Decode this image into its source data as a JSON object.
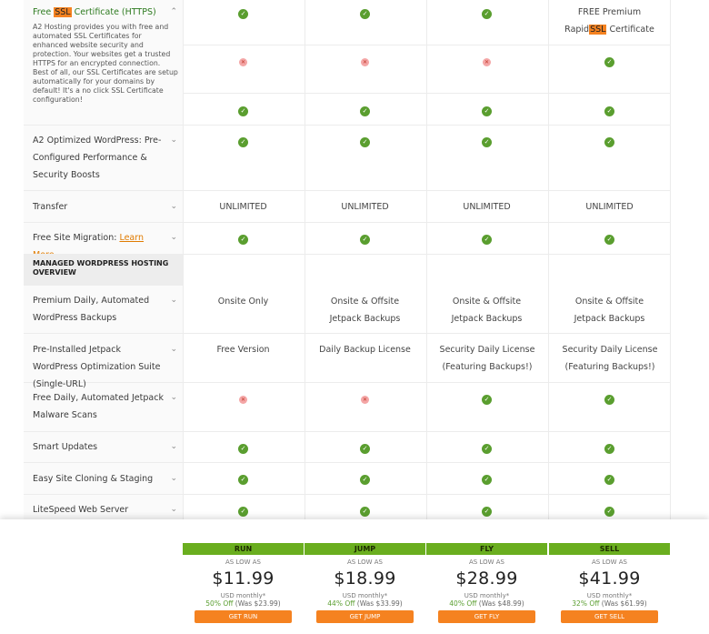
{
  "features": {
    "ssl": {
      "label_pre": "Free ",
      "label_hl": "SSL",
      "label_post": " Certificate (HTTPS)",
      "description": "A2 Hosting provides you with free and automated SSL Certificates for enhanced website security and protection. Your websites get a trusted HTTPS for an encrypted connection. Best of all, our SSL Certificates are setup automatically for your domains by default! It's a no click SSL Certificate configuration!",
      "sell_line1": "FREE Premium",
      "sell_pre": "Rapid",
      "sell_hl": "SSL",
      "sell_post": " Certificate"
    },
    "wp": {
      "label": "A2 Optimized WordPress: Pre-Configured Performance & Security Boosts"
    },
    "transfer": {
      "label": "Transfer",
      "value": "UNLIMITED"
    },
    "migration": {
      "label": "Free Site Migration: ",
      "link": "Learn More"
    },
    "section_title": "MANAGED WORDPRESS HOSTING OVERVIEW",
    "backups": {
      "label": "Premium Daily, Automated WordPress Backups",
      "run": "Onsite Only",
      "other": "Onsite & Offsite Jetpack Backups"
    },
    "jetpack": {
      "label": "Pre-Installed Jetpack WordPress Optimization Suite (Single-URL)",
      "run": "Free Version",
      "jump": "Daily Backup License",
      "fly": "Security Daily License (Featuring Backups!)",
      "sell": "Security Daily License (Featuring Backups!)"
    },
    "malware": {
      "label": "Free Daily, Automated Jetpack Malware Scans"
    },
    "smart": {
      "label": "Smart Updates"
    },
    "cloning": {
      "label": "Easy Site Cloning & Staging"
    },
    "litespeed": {
      "label": "LiteSpeed Web Server"
    }
  },
  "plans": [
    {
      "name": "RUN",
      "low": "AS LOW AS",
      "price": "$11.99",
      "monthly": "USD monthly*",
      "off": "50% Off",
      "was": "(Was $23.99)",
      "button": "GET RUN"
    },
    {
      "name": "JUMP",
      "low": "AS LOW AS",
      "price": "$18.99",
      "monthly": "USD monthly*",
      "off": "44% Off",
      "was": "(Was $33.99)",
      "button": "GET JUMP"
    },
    {
      "name": "FLY",
      "low": "AS LOW AS",
      "price": "$28.99",
      "monthly": "USD monthly*",
      "off": "40% Off",
      "was": "(Was $48.99)",
      "button": "GET FLY"
    },
    {
      "name": "SELL",
      "low": "AS LOW AS",
      "price": "$41.99",
      "monthly": "USD monthly*",
      "off": "32% Off",
      "was": "(Was $61.99)",
      "button": "GET SELL"
    }
  ],
  "icons": {
    "check": "check-icon",
    "cross": "cross-icon",
    "chevron": "chevron-down-icon"
  },
  "colors": {
    "accent": "#6aae1f",
    "button": "#f58220",
    "check": "#5a9e2f"
  }
}
